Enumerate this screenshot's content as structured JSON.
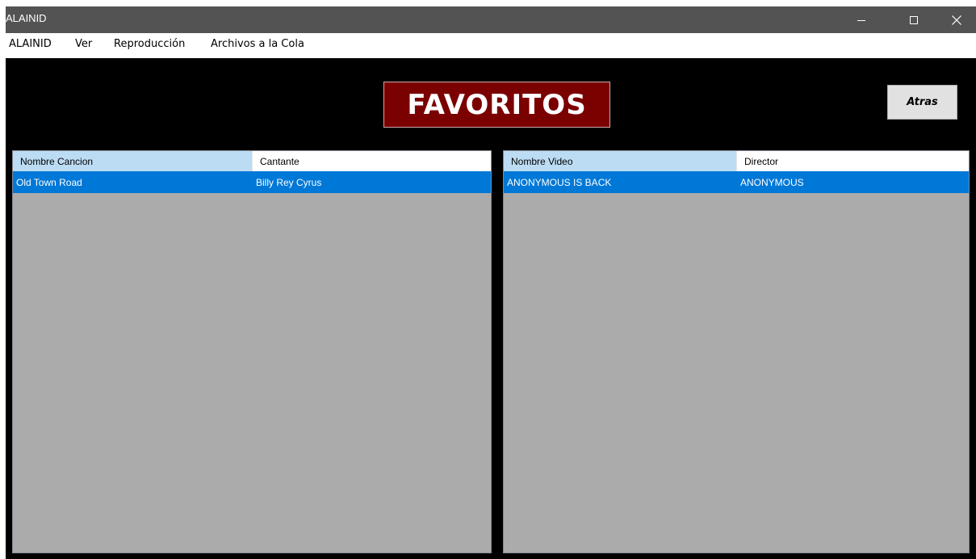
{
  "window": {
    "title": "ALAINID"
  },
  "window_controls": {
    "minimize_icon": "minimize-icon",
    "maximize_icon": "maximize-icon",
    "close_icon": "close-icon"
  },
  "menubar": {
    "items": [
      {
        "label": "ALAINID"
      },
      {
        "label": "Ver"
      },
      {
        "label": "Reproducción"
      },
      {
        "label": "Archivos a la Cola"
      }
    ]
  },
  "banner": {
    "text": "FAVORITOS"
  },
  "back_button": {
    "label": "Atras"
  },
  "songs_list": {
    "columns": [
      "Nombre Cancion",
      "Cantante"
    ],
    "rows": [
      {
        "name": "Old Town Road",
        "artist": "Billy Rey Cyrus",
        "selected": true
      }
    ]
  },
  "videos_list": {
    "columns": [
      "Nombre Video",
      "Director"
    ],
    "rows": [
      {
        "name": "ANONYMOUS IS BACK",
        "director": "ANONYMOUS",
        "selected": true
      }
    ]
  },
  "colors": {
    "titlebar": "#535353",
    "background": "#000000",
    "banner": "#7b0000",
    "list_background": "#ababab",
    "selection": "#0078d7",
    "header_highlight": "#bcdcf4"
  }
}
